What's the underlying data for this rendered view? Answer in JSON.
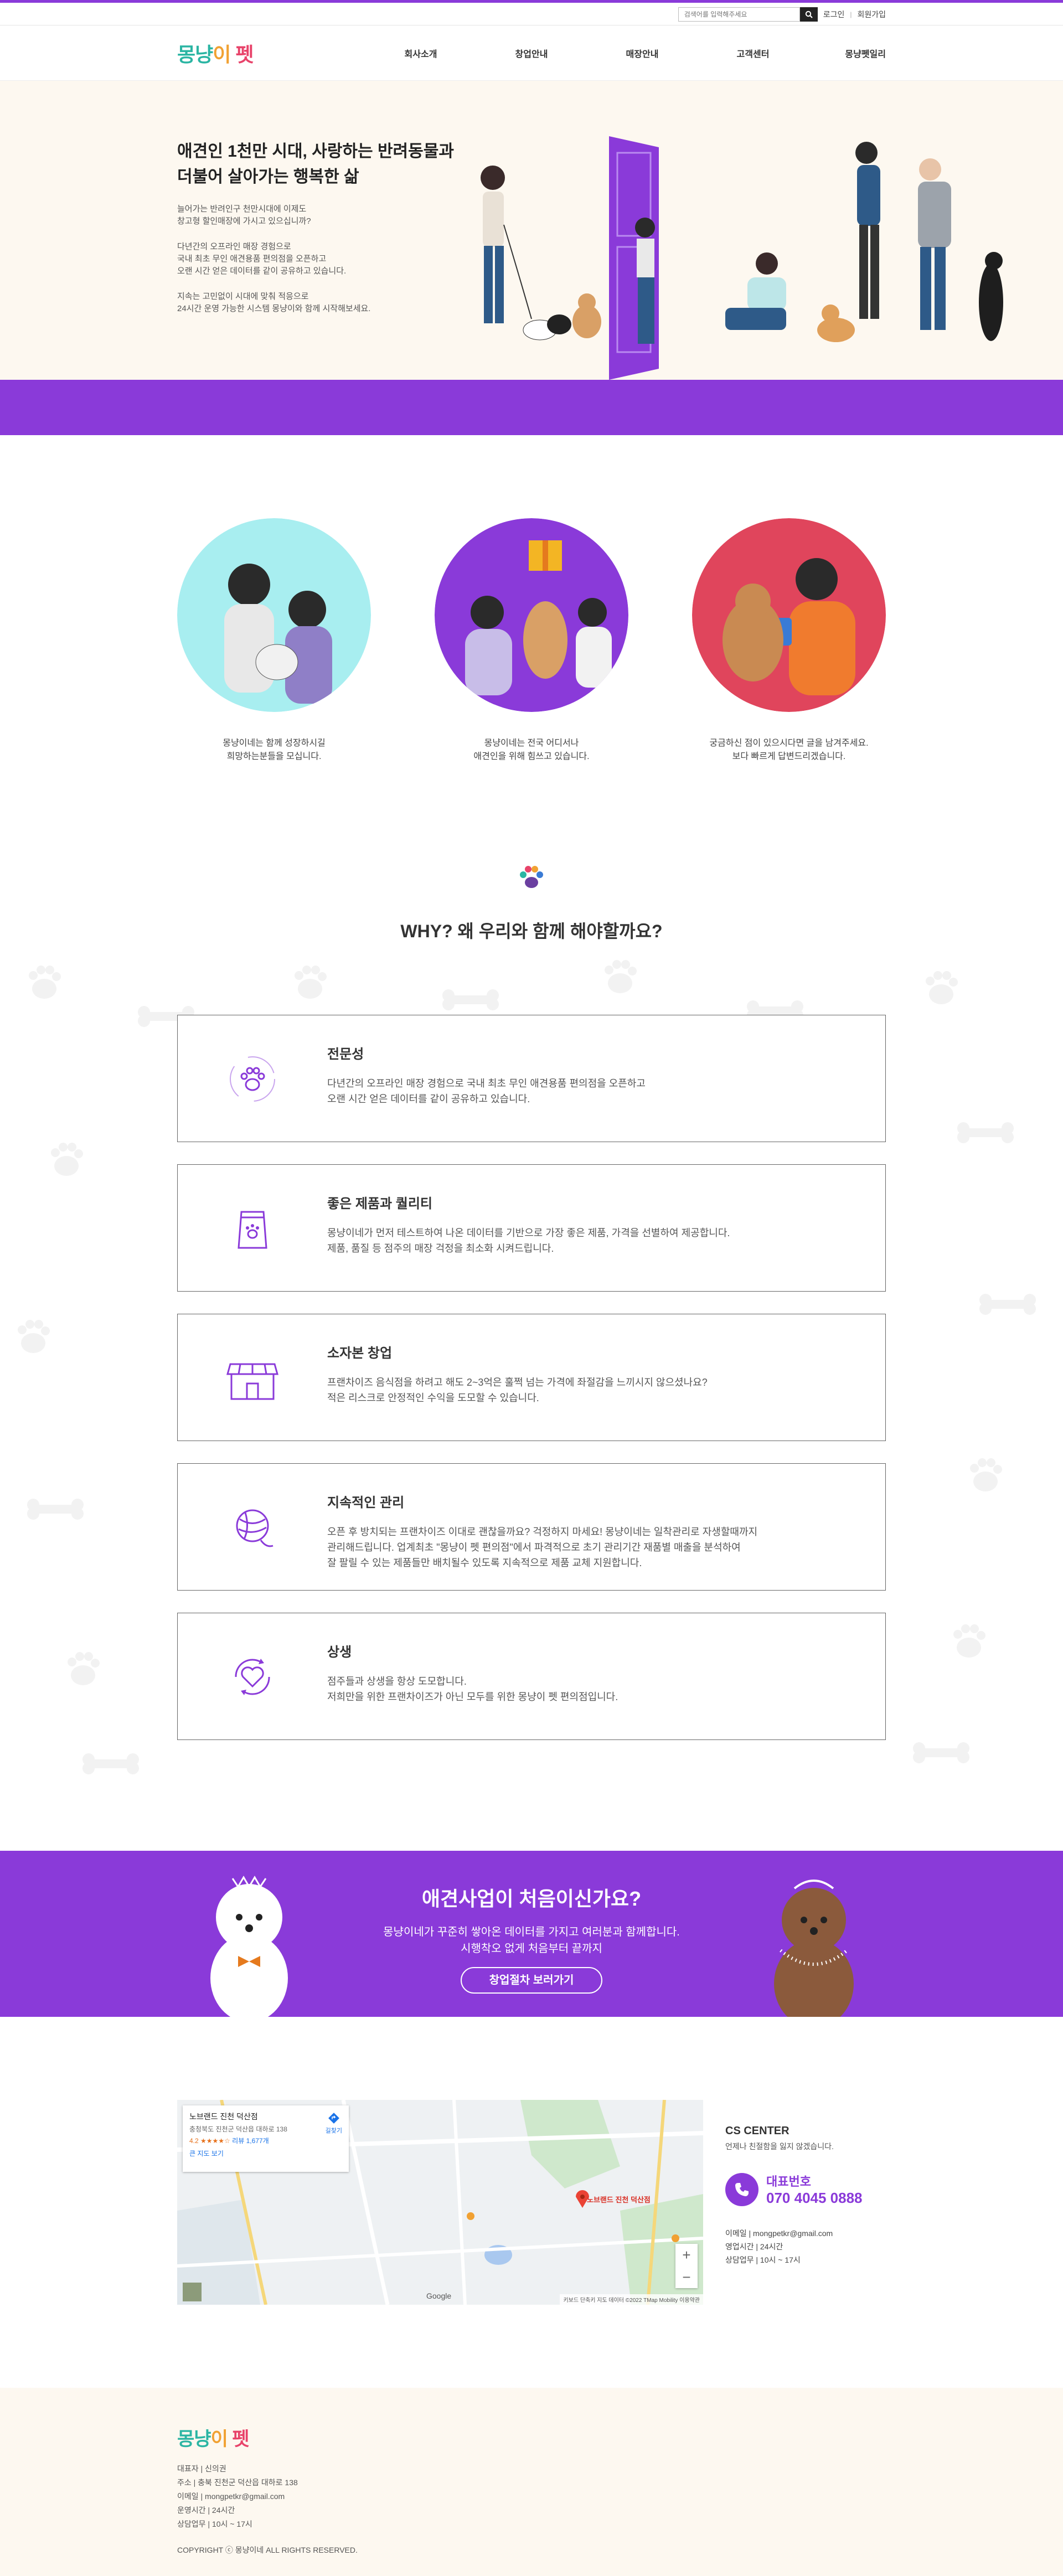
{
  "topbar": {
    "search_placeholder": "검색어를 입력해주세요",
    "login": "로그인",
    "sep": "|",
    "signup": "회원가입"
  },
  "header": {
    "logo_parts": [
      "몽냥",
      "이",
      " 펫"
    ],
    "nav": [
      "회사소개",
      "창업안내",
      "매장안내",
      "고객센터",
      "몽냥펫일리"
    ]
  },
  "hero": {
    "title": "애견인 1천만 시대, 사랑하는 반려동물과\n더불어 살아가는 행복한 삶",
    "p1": "늘어가는 반려인구 천만시대에 이제도\n창고형 할인매장에 가시고 있으십니까?",
    "p2": "다년간의 오프라인 매장 경험으로\n국내 최초 무인 애견용품 편의점을 오픈하고\n오랜 시간 얻은 데이터를 같이 공유하고 있습니다.",
    "p3": "지속는 고민없이 시대에 맞춰 적응으로\n24시간 운영 가능한 시스템 몽냥이와 함께 시작해보세요."
  },
  "circles": [
    {
      "text": "몽냥이네는 함께 성장하시길\n희망하는분들을 모십니다."
    },
    {
      "text": "몽냥이네는 전국 어디서나\n애견인을 위해 힘쓰고 있습니다."
    },
    {
      "text": "궁금하신 점이 있으시다면 글을 남겨주세요.\n보다 빠르게 답변드리겠습니다."
    }
  ],
  "why": {
    "title": "WHY? 왜 우리와 함께 해야할까요?",
    "cards": [
      {
        "icon": "paw-icon",
        "title": "전문성",
        "desc": "다년간의 오프라인 매장 경험으로 국내 최초 무인 애견용품 편의점을 오픈하고\n오랜 시간 얻은 데이터를 같이 공유하고 있습니다."
      },
      {
        "icon": "pet-food-bag-icon",
        "title": "좋은 제품과 퀄리티",
        "desc": "몽냥이네가 먼저 테스트하여 나온 데이터를 기반으로 가장 좋은 제품, 가격을 선별하여 제공합니다.\n제품, 품질 등 점주의 매장 걱정을 최소화 시켜드립니다."
      },
      {
        "icon": "store-icon",
        "title": "소자본 창업",
        "desc": "프랜차이즈 음식점을 하려고 해도 2~3억은 훌쩍 넘는 가격에 좌절감을 느끼시지 않으셨나요?\n적은 리스크로 안정적인 수익을 도모할 수 있습니다."
      },
      {
        "icon": "yarn-ball-icon",
        "title": "지속적인 관리",
        "desc": "오픈 후 방치되는 프랜차이즈 이대로 괜찮을까요? 걱정하지 마세요! 몽냥이네는 일착관리로 자생할때까지\n관리해드립니다. 업계최초 \"몽냥이 펫 편의점\"에서 파격적으로 초기 관리기간 재품별 매출을 분석하여\n잘 팔릴 수 있는 제품들만 배치될수 있도록 지속적으로 제품 교체 지원합니다."
      },
      {
        "icon": "heart-cycle-icon",
        "title": "상생",
        "desc": "점주들과 상생을 항상 도모합니다.\n저희만을 위한 프랜차이즈가 아닌 모두를 위한 몽냥이 펫 편의점입니다."
      }
    ]
  },
  "banner": {
    "title": "애견사업이 처음이신가요?",
    "desc": "몽냥이네가 꾸준히 쌓아온 데이터를 가지고 여러분과 함께합니다.\n시행착오 없게 처음부터 끝까지",
    "button": "창업절차 보러가기"
  },
  "map": {
    "place_name": "노브랜드 진천 덕산점",
    "address": "충청북도 진천군 덕산읍 대하로 138",
    "rating": "4.2 ★★★★☆",
    "reviews": "리뷰 1,677개",
    "larger_map": "큰 지도 보기",
    "directions": "길찾기",
    "pin_label": "노브랜드 진천 덕산점",
    "google": "Google",
    "attribution": "키보드 단축키  지도 데이터 ©2022 TMap Mobility  이용약관",
    "zoom_in": "+",
    "zoom_out": "−"
  },
  "cs": {
    "title": "CS CENTER",
    "sub": "언제나 친절함을 잃지 않겠습니다.",
    "phone_label": "대표번호",
    "phone": "070 4045 0888",
    "email": "이메일  |  mongpetkr@gmail.com",
    "hours": "영업시간  |  24시간",
    "counsel": "상담업무  |  10시 ~ 17시"
  },
  "footer": {
    "lines": [
      "대표자  |  신의권",
      "주소  |  충북 진천군 덕산읍 대하로 138",
      "이메일  |  mongpetkr@gmail.com",
      "운영시간  |  24시간",
      "상담업무  |  10시 ~ 17시"
    ],
    "copyright": "COPYRIGHT ⓒ 몽냥이네 ALL RIGHTS RESERVED."
  },
  "colors": {
    "brand_purple": "#8a3ad9",
    "cream": "#fdf8f0",
    "logo_teal": "#2bb5a3",
    "logo_orange": "#f1a132",
    "logo_pink": "#e8436a"
  }
}
